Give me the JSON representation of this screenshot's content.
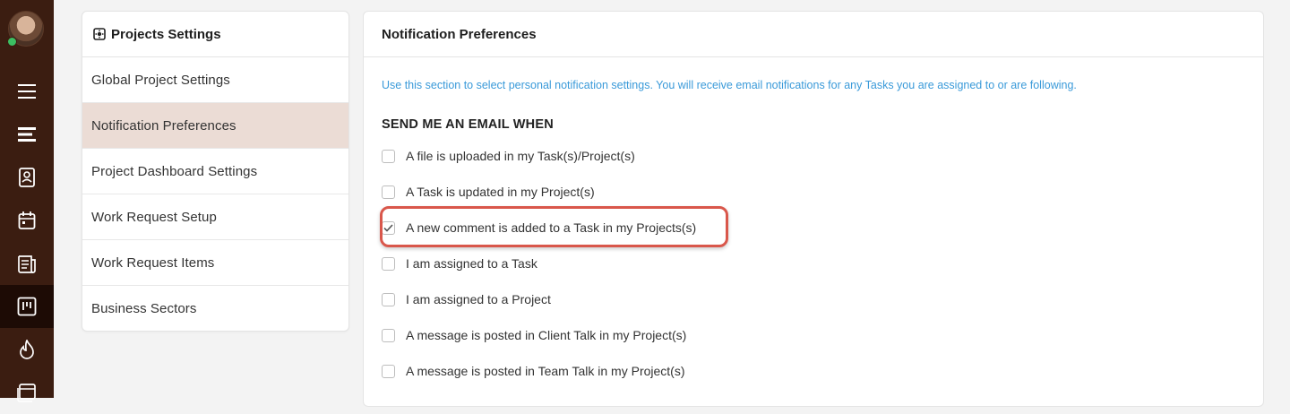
{
  "menu": {
    "title": "Projects Settings",
    "items": [
      {
        "label": "Global Project Settings"
      },
      {
        "label": "Notification Preferences"
      },
      {
        "label": "Project Dashboard Settings"
      },
      {
        "label": "Work Request Setup"
      },
      {
        "label": "Work Request Items"
      },
      {
        "label": "Business Sectors"
      }
    ],
    "selected": "Notification Preferences"
  },
  "panel": {
    "title": "Notification Preferences",
    "info": "Use this section to select personal notification settings. You will receive email notifications for any Tasks you are assigned to or are following.",
    "section_heading": "SEND ME AN EMAIL WHEN",
    "options": [
      {
        "label": "A file is uploaded in my Task(s)/Project(s)",
        "checked": false
      },
      {
        "label": "A Task is updated in my Project(s)",
        "checked": false
      },
      {
        "label": "A new comment is added to a Task in my Projects(s)",
        "checked": true
      },
      {
        "label": "I am assigned to a Task",
        "checked": false
      },
      {
        "label": "I am assigned to a Project",
        "checked": false
      },
      {
        "label": "A message is posted in Client Talk in my Project(s)",
        "checked": false
      },
      {
        "label": "A message is posted in Team Talk in my Project(s)",
        "checked": false
      }
    ]
  },
  "rail": {
    "icons": [
      "avatar",
      "hamburger-icon",
      "list-icon",
      "contacts-icon",
      "calendar-icon",
      "documents-icon",
      "projects-board-icon",
      "fire-icon",
      "browser-icon"
    ],
    "active": "projects-board-icon"
  },
  "colors": {
    "rail": "#3b1d11",
    "selected_menu": "#ebdcd5",
    "info_text": "#3a9ad9",
    "highlight": "#d9574b"
  }
}
